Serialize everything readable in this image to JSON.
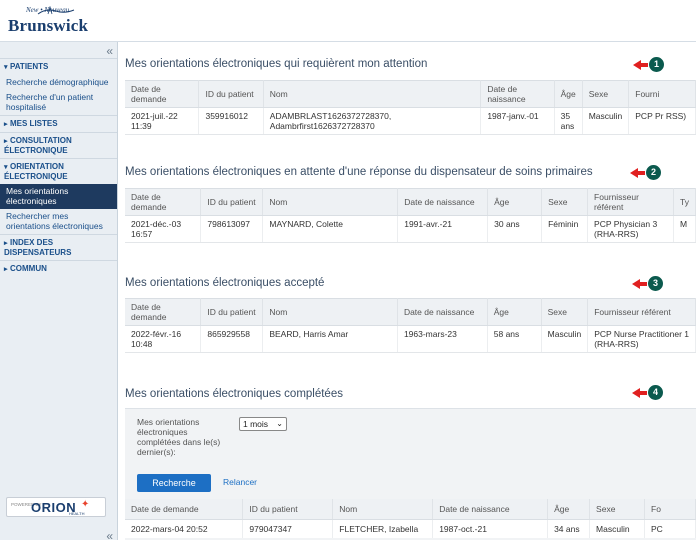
{
  "header": {
    "logo_small": "New • Nouveau",
    "logo_big": "Brunswick"
  },
  "sidebar": {
    "collapse": "«",
    "sections": [
      {
        "label": "PATIENTS",
        "arrow": "▾",
        "items": [
          "Recherche démographique",
          "Recherche d'un patient hospitalisé"
        ]
      },
      {
        "label": "MES LISTES",
        "arrow": "▸",
        "items": []
      },
      {
        "label": "CONSULTATION ÉLECTRONIQUE",
        "arrow": "▸",
        "items": []
      },
      {
        "label": "ORIENTATION ÉLECTRONIQUE",
        "arrow": "▾",
        "items": [
          "Mes orientations électroniques",
          "Rechercher mes orientations électroniques"
        ]
      },
      {
        "label": "INDEX DES DISPENSATEURS",
        "arrow": "▸",
        "items": []
      },
      {
        "label": "COMMUN",
        "arrow": "▸",
        "items": []
      }
    ],
    "powered": {
      "by": "POWERED BY",
      "brand": "ORION",
      "sub": "HEALTH"
    }
  },
  "sections": [
    {
      "title": "Mes orientations électroniques qui requièrent mon attention",
      "marker": "1",
      "headers": [
        "Date de demande",
        "ID du patient",
        "Nom",
        "Date de naissance",
        "Âge",
        "Sexe",
        "Fourni"
      ],
      "rows": [
        [
          "2021-juil.-22 11:39",
          "359916012",
          "ADAMBRLAST1626372728370, Adambrfirst1626372728370",
          "1987-janv.-01",
          "35 ans",
          "Masculin",
          "PCP Pr RSS)"
        ]
      ]
    },
    {
      "title": "Mes orientations électroniques en attente d'une réponse du dispensateur de soins primaires",
      "marker": "2",
      "headers": [
        "Date de demande",
        "ID du patient",
        "Nom",
        "Date de naissance",
        "Âge",
        "Sexe",
        "Fournisseur référent",
        "Ty"
      ],
      "rows": [
        [
          "2021-déc.-03 16:57",
          "798613097",
          "MAYNARD, Colette",
          "1991-avr.-21",
          "30 ans",
          "Féminin",
          "PCP Physician 3 (RHA-RRS)",
          "M"
        ]
      ]
    },
    {
      "title": "Mes orientations électroniques accepté",
      "marker": "3",
      "headers": [
        "Date de demande",
        "ID du patient",
        "Nom",
        "Date de naissance",
        "Âge",
        "Sexe",
        "Fournisseur référent"
      ],
      "rows": [
        [
          "2022-févr.-16 10:48",
          "865929558",
          "BEARD, Harris Amar",
          "1963-mars-23",
          "58 ans",
          "Masculin",
          "PCP Nurse Practitioner 1 (RHA-RRS)"
        ]
      ]
    },
    {
      "title": "Mes orientations électroniques complétées",
      "marker": "4",
      "filter_label": "Mes orientations électroniques complétées dans le(s) dernier(s):",
      "period": "1 mois",
      "search_label": "Recherche",
      "reset_label": "Relancer",
      "headers": [
        "Date de demande",
        "ID du patient",
        "Nom",
        "Date de naissance",
        "Âge",
        "Sexe",
        "Fo"
      ],
      "rows": [
        [
          "2022-mars-04 20:52",
          "979047347",
          "FLETCHER, Izabella",
          "1987-oct.-21",
          "34 ans",
          "Masculin",
          "PC"
        ]
      ]
    }
  ]
}
